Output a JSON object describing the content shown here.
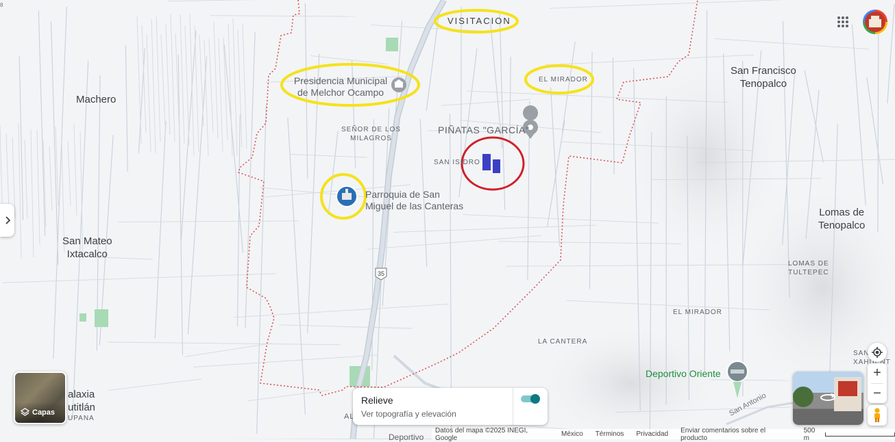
{
  "map": {
    "places": {
      "visitacion": "VISITACION",
      "presidencia_line1": "Presidencia Municipal",
      "presidencia_line2": "de Melchor Ocampo",
      "el_mirador_top": "EL MIRADOR",
      "machero": "Machero",
      "senor_milagros_line1": "SEÑOR DE LOS",
      "senor_milagros_line2": "MILAGROS",
      "pinatas": "PIÑATAS \"GARCÍA\"",
      "san_isidro": "SAN ISIDRO",
      "parroquia_line1": "Parroquia de San",
      "parroquia_line2": "Miguel de las Canteras",
      "san_mateo_line1": "San Mateo",
      "san_mateo_line2": "Ixtacalco",
      "san_francisco_line1": "San Francisco",
      "san_francisco_line2": "Tenopalco",
      "lomas_tenopalco_line1": "Lomas de",
      "lomas_tenopalco_line2": "Tenopalco",
      "lomas_tultepec_line1": "LOMAS DE",
      "lomas_tultepec_line2": "TULTEPEC",
      "el_mirador_bottom": "EL MIRADOR",
      "la_cantera": "LA CANTERA",
      "deportivo_oriente": "Deportivo Oriente",
      "san_antonio": "San Antonio",
      "xahuento_line1": "SAN",
      "xahuento_line2": "XAHUENT",
      "galaxia_line1": "alaxia",
      "galaxia_line2": "utitlán",
      "galaxia_line3": "UPANA",
      "bottom_al": "AL",
      "bottom_deportivo": "Deportivo",
      "route_35": "35",
      "corner_digit": "8"
    },
    "colors": {
      "highlight_yellow": "#f5e21b",
      "highlight_red": "#d0202a",
      "marker_blue": "#3b3fc4",
      "boundary": "#d9534f",
      "park_green": "#a8dab5",
      "poi_green": "#1e8e3e"
    }
  },
  "controls": {
    "layers_label": "Capas",
    "relief_title": "Relieve",
    "relief_subtitle": "Ver topografía y elevación",
    "relief_toggle_on": true,
    "zoom_in": "+",
    "zoom_out": "−",
    "expand_panel_icon": "chevron-right-icon",
    "apps_icon": "grid-icon",
    "location_icon": "my-location-icon",
    "pegman_icon": "pegman-icon"
  },
  "footer": {
    "map_data": "Datos del mapa ©2025 INEGI, Google",
    "country": "México",
    "terms": "Términos",
    "privacy": "Privacidad",
    "feedback": "Enviar comentarios sobre el producto",
    "scale": "500 m"
  }
}
